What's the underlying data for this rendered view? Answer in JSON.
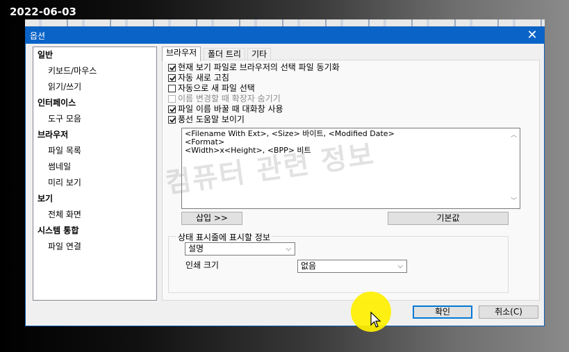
{
  "date_stamp": "2022-06-03",
  "dialog": {
    "title": "옵션",
    "close_symbol": "✕"
  },
  "sidebar": {
    "items": [
      {
        "label": "일반",
        "type": "category"
      },
      {
        "label": "키보드/마우스",
        "type": "sub"
      },
      {
        "label": "읽기/쓰기",
        "type": "sub"
      },
      {
        "label": "인터페이스",
        "type": "category"
      },
      {
        "label": "도구 모음",
        "type": "sub"
      },
      {
        "label": "브라우저",
        "type": "category"
      },
      {
        "label": "파일 목록",
        "type": "sub"
      },
      {
        "label": "썸네일",
        "type": "sub"
      },
      {
        "label": "미리 보기",
        "type": "sub"
      },
      {
        "label": "보기",
        "type": "category"
      },
      {
        "label": "전체 화면",
        "type": "sub"
      },
      {
        "label": "시스템 통합",
        "type": "category"
      },
      {
        "label": "파일 연결",
        "type": "sub"
      }
    ]
  },
  "tabs": [
    {
      "label": "브라우저",
      "active": true
    },
    {
      "label": "폴더 트리",
      "active": false
    },
    {
      "label": "기타",
      "active": false
    }
  ],
  "options": [
    {
      "label": "현재 보기 파일로 브라우저의 선택 파일 동기화",
      "checked": true,
      "disabled": false
    },
    {
      "label": "자동 새로 고침",
      "checked": true,
      "disabled": false
    },
    {
      "label": "자동으로 새 파일 선택",
      "checked": false,
      "disabled": false
    },
    {
      "label": "이름 변경할 때 확장자 숨기기",
      "checked": false,
      "disabled": true
    },
    {
      "label": "파일 이름 바꿀 때 대화창 사용",
      "checked": true,
      "disabled": false
    },
    {
      "label": "풍선 도움말 보이기",
      "checked": true,
      "disabled": false
    }
  ],
  "tooltip_format": {
    "lines": [
      "<Filename With Ext>, <Size> 바이트, <Modified Date>",
      "<Format>",
      "<Width>x<Height>, <BPP> 비트"
    ]
  },
  "buttons": {
    "insert": "삽입 >>",
    "default": "기본값",
    "ok": "확인",
    "cancel": "취소(C)"
  },
  "statusbar_group": {
    "title": "상태 표시줄에 표시할 정보",
    "info_select_value": "설명",
    "print_size_label": "인쇄 크기",
    "print_size_value": "없음"
  },
  "watermark": "컴퓨터 관련 정보"
}
